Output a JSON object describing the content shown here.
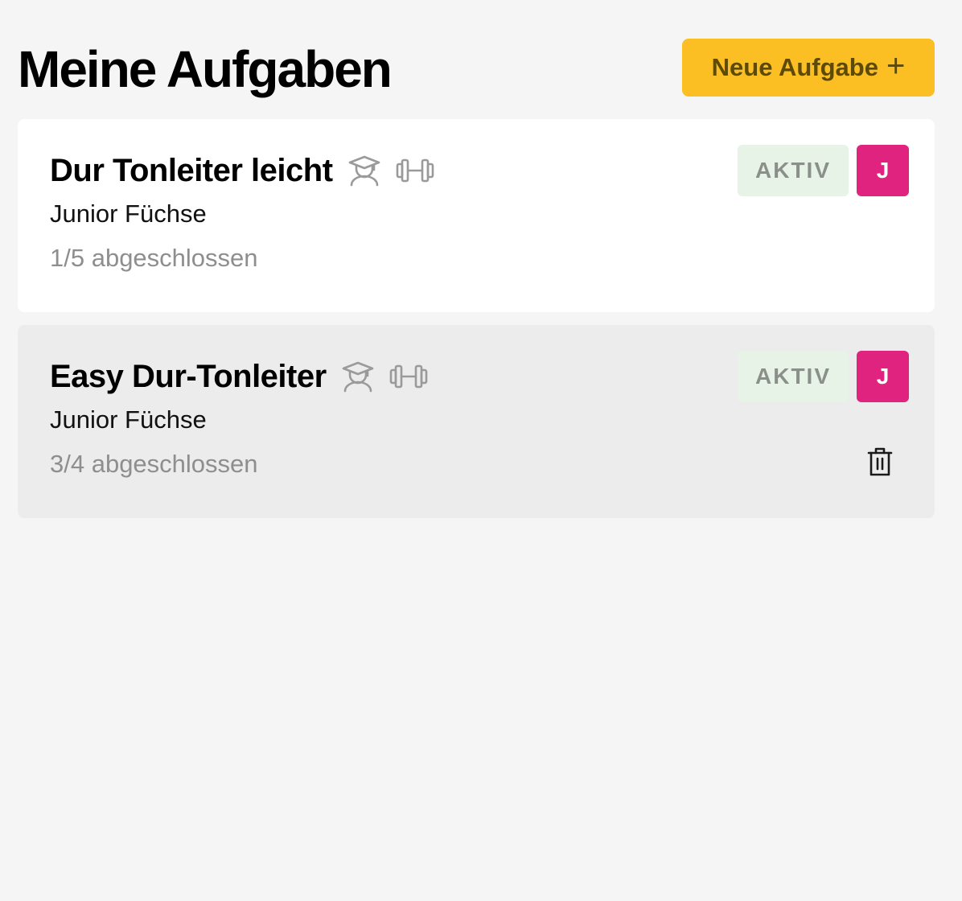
{
  "header": {
    "title": "Meine Aufgaben",
    "new_button_label": "Neue Aufgabe",
    "new_button_icon": "+"
  },
  "tasks": [
    {
      "title": "Dur Tonleiter leicht",
      "icons": [
        "student-icon",
        "dumbbell-icon"
      ],
      "team": "Junior Füchse",
      "progress": "1/5 abgeschlossen",
      "status": "AKTIV",
      "avatar_initial": "J",
      "has_delete": false
    },
    {
      "title": "Easy Dur-Tonleiter",
      "icons": [
        "student-icon",
        "dumbbell-icon"
      ],
      "team": "Junior Füchse",
      "progress": "3/4 abgeschlossen",
      "status": "AKTIV",
      "avatar_initial": "J",
      "has_delete": true
    }
  ],
  "colors": {
    "background": "#f5f5f5",
    "accent_button": "#fbbf24",
    "avatar": "#e0237f",
    "status_badge_bg": "#e8f3e8",
    "card_hover_bg": "#ececec"
  }
}
